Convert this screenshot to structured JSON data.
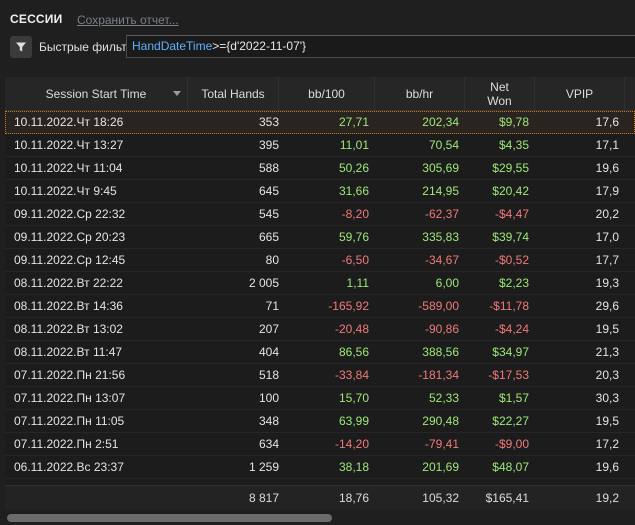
{
  "panel": {
    "title": "СЕССИИ",
    "save_link": "Сохранить отчет..."
  },
  "filter": {
    "icon": "filter-icon",
    "label": "Быстрые фильтры",
    "expression_key": "HandDateTime",
    "expression_rest": ">={d'2022-11-07'}"
  },
  "table": {
    "columns": [
      "Session Start Time",
      "Total Hands",
      "bb/100",
      "bb/hr",
      "Net Won",
      "VPIP"
    ],
    "sort_column": "Session Start Time",
    "sort_direction": "descending",
    "rows": [
      {
        "time": "10.11.2022.Чт 18:26",
        "hands": "353",
        "bb100": "27,71",
        "bbhr": "202,34",
        "net": "$9,78",
        "vpip": "17,6",
        "selected": true
      },
      {
        "time": "10.11.2022.Чт 13:27",
        "hands": "395",
        "bb100": "11,01",
        "bbhr": "70,54",
        "net": "$4,35",
        "vpip": "17,1"
      },
      {
        "time": "10.11.2022.Чт 11:04",
        "hands": "588",
        "bb100": "50,26",
        "bbhr": "305,69",
        "net": "$29,55",
        "vpip": "19,6"
      },
      {
        "time": "10.11.2022.Чт 9:45",
        "hands": "645",
        "bb100": "31,66",
        "bbhr": "214,95",
        "net": "$20,42",
        "vpip": "17,9"
      },
      {
        "time": "09.11.2022.Ср 22:32",
        "hands": "545",
        "bb100": "-8,20",
        "bbhr": "-62,37",
        "net": "-$4,47",
        "vpip": "20,2"
      },
      {
        "time": "09.11.2022.Ср 20:23",
        "hands": "665",
        "bb100": "59,76",
        "bbhr": "335,83",
        "net": "$39,74",
        "vpip": "17,0"
      },
      {
        "time": "09.11.2022.Ср 12:45",
        "hands": "80",
        "bb100": "-6,50",
        "bbhr": "-34,67",
        "net": "-$0,52",
        "vpip": "17,7"
      },
      {
        "time": "08.11.2022.Вт 22:22",
        "hands": "2 005",
        "bb100": "1,11",
        "bbhr": "6,00",
        "net": "$2,23",
        "vpip": "19,3"
      },
      {
        "time": "08.11.2022.Вт 14:36",
        "hands": "71",
        "bb100": "-165,92",
        "bbhr": "-589,00",
        "net": "-$11,78",
        "vpip": "29,6"
      },
      {
        "time": "08.11.2022.Вт 13:02",
        "hands": "207",
        "bb100": "-20,48",
        "bbhr": "-90,86",
        "net": "-$4,24",
        "vpip": "19,5"
      },
      {
        "time": "08.11.2022.Вт 11:47",
        "hands": "404",
        "bb100": "86,56",
        "bbhr": "388,56",
        "net": "$34,97",
        "vpip": "21,3"
      },
      {
        "time": "07.11.2022.Пн 21:56",
        "hands": "518",
        "bb100": "-33,84",
        "bbhr": "-181,34",
        "net": "-$17,53",
        "vpip": "20,3"
      },
      {
        "time": "07.11.2022.Пн 13:07",
        "hands": "100",
        "bb100": "15,70",
        "bbhr": "52,33",
        "net": "$1,57",
        "vpip": "30,3"
      },
      {
        "time": "07.11.2022.Пн 11:05",
        "hands": "348",
        "bb100": "63,99",
        "bbhr": "290,48",
        "net": "$22,27",
        "vpip": "19,5"
      },
      {
        "time": "07.11.2022.Пн 2:51",
        "hands": "634",
        "bb100": "-14,20",
        "bbhr": "-79,41",
        "net": "-$9,00",
        "vpip": "17,2"
      },
      {
        "time": "06.11.2022.Вс 23:37",
        "hands": "1 259",
        "bb100": "38,18",
        "bbhr": "201,69",
        "net": "$48,07",
        "vpip": "19,6"
      }
    ],
    "totals": {
      "hands": "8 817",
      "bb100": "18,76",
      "bbhr": "105,32",
      "net": "$165,41",
      "vpip": "19,2"
    }
  },
  "colors": {
    "positive": "#9ee87a",
    "negative": "#f07a7a",
    "selection_outline": "#c8781e",
    "filter_key": "#5fb0ff"
  }
}
